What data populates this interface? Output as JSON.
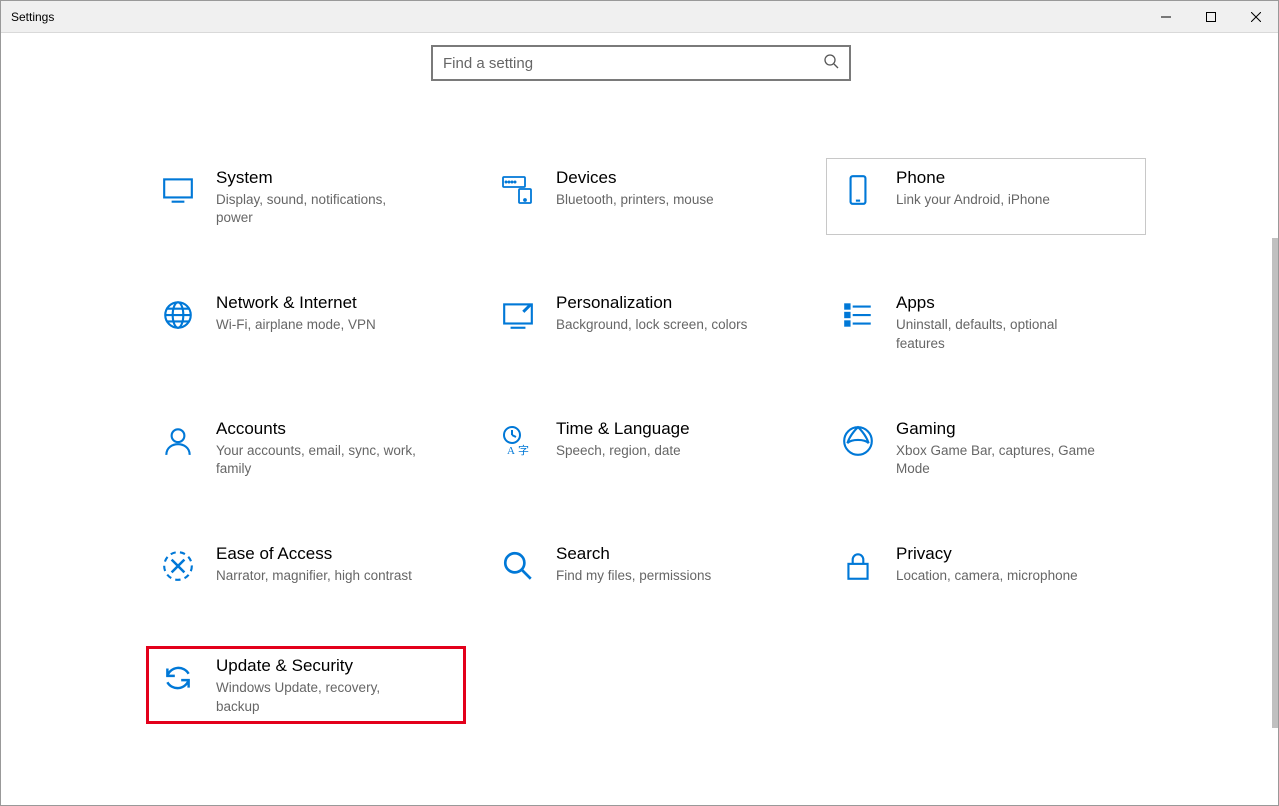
{
  "window": {
    "title": "Settings"
  },
  "search": {
    "placeholder": "Find a setting"
  },
  "tiles": {
    "system": {
      "title": "System",
      "desc": "Display, sound, notifications, power"
    },
    "devices": {
      "title": "Devices",
      "desc": "Bluetooth, printers, mouse"
    },
    "phone": {
      "title": "Phone",
      "desc": "Link your Android, iPhone"
    },
    "network": {
      "title": "Network & Internet",
      "desc": "Wi-Fi, airplane mode, VPN"
    },
    "personalization": {
      "title": "Personalization",
      "desc": "Background, lock screen, colors"
    },
    "apps": {
      "title": "Apps",
      "desc": "Uninstall, defaults, optional features"
    },
    "accounts": {
      "title": "Accounts",
      "desc": "Your accounts, email, sync, work, family"
    },
    "time": {
      "title": "Time & Language",
      "desc": "Speech, region, date"
    },
    "gaming": {
      "title": "Gaming",
      "desc": "Xbox Game Bar, captures, Game Mode"
    },
    "ease": {
      "title": "Ease of Access",
      "desc": "Narrator, magnifier, high contrast"
    },
    "searchcat": {
      "title": "Search",
      "desc": "Find my files, permissions"
    },
    "privacy": {
      "title": "Privacy",
      "desc": "Location, camera, microphone"
    },
    "update": {
      "title": "Update & Security",
      "desc": "Windows Update, recovery, backup"
    }
  }
}
